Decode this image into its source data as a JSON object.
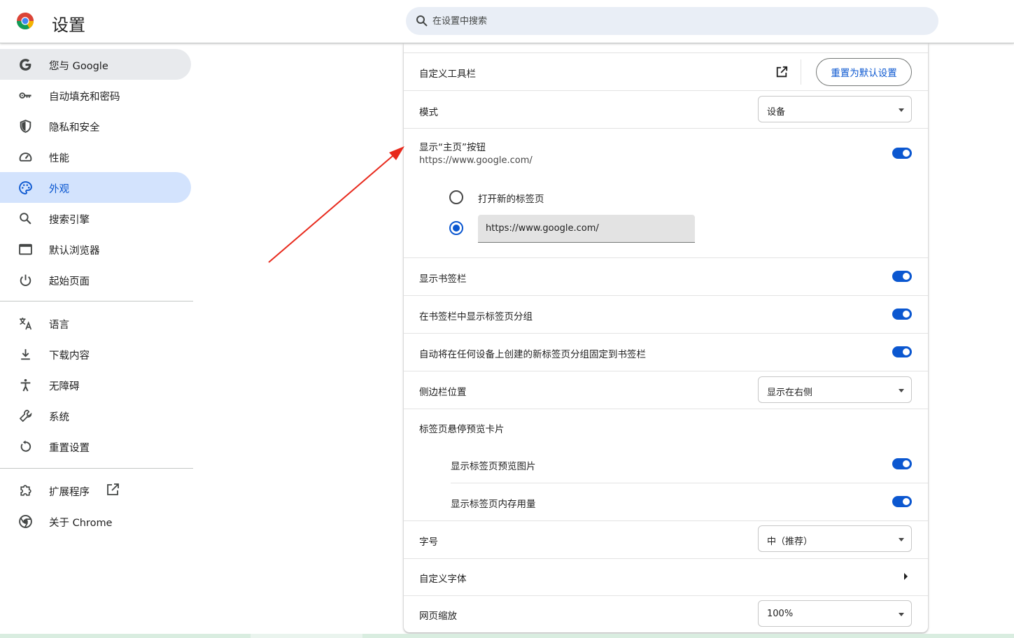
{
  "header": {
    "title": "设置",
    "search_placeholder": "在设置中搜索"
  },
  "sidebar": {
    "items": [
      {
        "label": "您与 Google",
        "icon": "google-g-icon"
      },
      {
        "label": "自动填充和密码",
        "icon": "key-icon"
      },
      {
        "label": "隐私和安全",
        "icon": "shield-icon"
      },
      {
        "label": "性能",
        "icon": "speedometer-icon"
      },
      {
        "label": "外观",
        "icon": "palette-icon"
      },
      {
        "label": "搜索引擎",
        "icon": "search-icon"
      },
      {
        "label": "默认浏览器",
        "icon": "browser-window-icon"
      },
      {
        "label": "起始页面",
        "icon": "power-icon"
      },
      {
        "label": "语言",
        "icon": "translate-icon"
      },
      {
        "label": "下载内容",
        "icon": "download-icon"
      },
      {
        "label": "无障碍",
        "icon": "accessibility-icon"
      },
      {
        "label": "系统",
        "icon": "wrench-icon"
      },
      {
        "label": "重置设置",
        "icon": "reset-icon"
      },
      {
        "label": "扩展程序",
        "icon": "puzzle-icon"
      },
      {
        "label": "关于 Chrome",
        "icon": "chrome-icon"
      }
    ]
  },
  "main": {
    "customize_toolbar": {
      "label": "自定义工具栏",
      "button": "重置为默认设置"
    },
    "mode": {
      "label": "模式",
      "value": "设备"
    },
    "home_button": {
      "label": "显示“主页”按钮",
      "sublabel": "https://www.google.com/",
      "enabled": true,
      "option_new_tab": "打开新的标签页",
      "custom_url": "https://www.google.com/"
    },
    "bookmarks_bar": {
      "label": "显示书签栏",
      "enabled": true
    },
    "tab_groups_in_bookmarks": {
      "label": "在书签栏中显示标签页分组",
      "enabled": true
    },
    "auto_pin_tab_groups": {
      "label": "自动将在任何设备上创建的新标签页分组固定到书签栏",
      "enabled": true
    },
    "side_panel": {
      "label": "侧边栏位置",
      "value": "显示在右侧"
    },
    "hover_card": {
      "label": "标签页悬停预览卡片",
      "preview_image": {
        "label": "显示标签页预览图片",
        "enabled": true
      },
      "memory_usage": {
        "label": "显示标签页内存用量",
        "enabled": true
      }
    },
    "font_size": {
      "label": "字号",
      "value": "中（推荐）"
    },
    "custom_fonts": {
      "label": "自定义字体"
    },
    "page_zoom": {
      "label": "网页缩放",
      "value": "100%"
    }
  },
  "colors": {
    "accent": "#0b57d0",
    "nav_selected": "#d3e3fd",
    "annotation_arrow": "#e8291c"
  }
}
